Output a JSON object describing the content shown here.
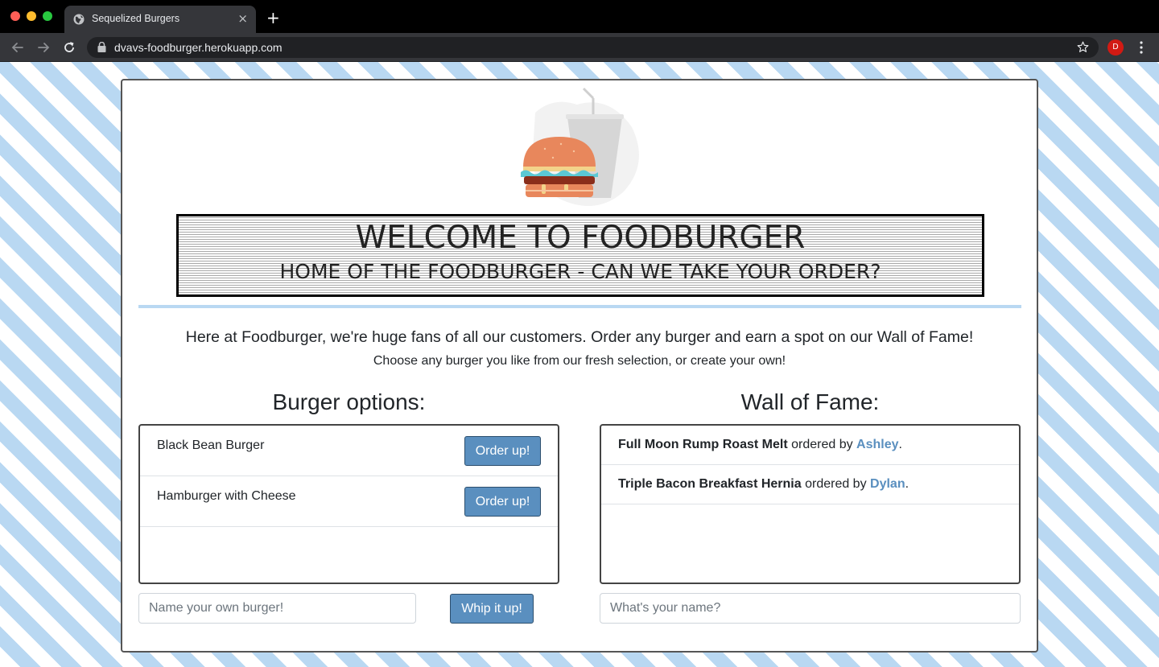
{
  "browser": {
    "tab_title": "Sequelized Burgers",
    "tab_close": "×",
    "new_tab": "+",
    "url": "dvavs-foodburger.herokuapp.com",
    "profile_initial": "D"
  },
  "banner": {
    "title": "WELCOME TO FOODBURGER",
    "subtitle": "HOME OF THE FOODBURGER - CAN WE TAKE YOUR ORDER?"
  },
  "intro": {
    "line1": "Here at Foodburger, we're huge fans of all our customers. Order any burger and earn a spot on our Wall of Fame!",
    "line2": "Choose any burger you like from our fresh selection, or create your own!"
  },
  "options": {
    "heading": "Burger options:",
    "items": [
      {
        "name": "Black Bean Burger",
        "button": "Order up!"
      },
      {
        "name": "Hamburger with Cheese",
        "button": "Order up!"
      }
    ],
    "input_placeholder": "Name your own burger!",
    "submit_label": "Whip it up!"
  },
  "fame": {
    "heading": "Wall of Fame:",
    "connector": " ordered by ",
    "period": ".",
    "entries": [
      {
        "burger": "Full Moon Rump Roast Melt",
        "customer": "Ashley"
      },
      {
        "burger": "Triple Bacon Breakfast Hernia",
        "customer": "Dylan"
      }
    ],
    "input_placeholder": "What's your name?"
  },
  "colors": {
    "accent": "#5a8fbf",
    "stripe": "#b9d8f2"
  },
  "icons": [
    "globe-icon",
    "back-arrow-icon",
    "forward-arrow-icon",
    "reload-icon",
    "lock-icon",
    "star-icon",
    "more-vert-icon",
    "burger-logo-icon"
  ]
}
